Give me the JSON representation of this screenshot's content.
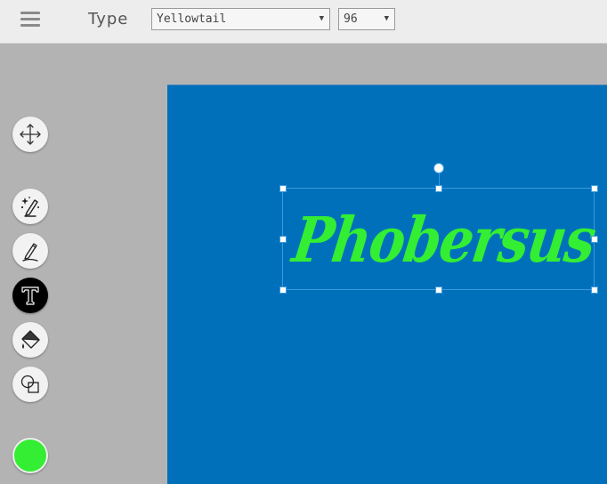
{
  "toolbar": {
    "menu_icon": "hamburger-menu-icon",
    "tool_name": "Type",
    "font_family": {
      "value": "Yellowtail",
      "arrow": "▼"
    },
    "font_size": {
      "value": "96",
      "arrow": "▼"
    }
  },
  "tools": [
    {
      "name": "move",
      "icon": "move-arrows-icon",
      "active": false
    },
    {
      "name": "magic-pen",
      "icon": "magic-pen-icon",
      "active": false
    },
    {
      "name": "pen",
      "icon": "pen-icon",
      "active": false
    },
    {
      "name": "type",
      "icon": "type-text-icon",
      "active": true
    },
    {
      "name": "fill",
      "icon": "paint-bucket-icon",
      "active": false
    },
    {
      "name": "shapes",
      "icon": "shapes-icon",
      "active": false
    }
  ],
  "colors": {
    "current": "#33ee33",
    "canvas_background": "#0070bb",
    "selection": "#3a9ae0"
  },
  "canvas": {
    "text_object": {
      "text": "Phobersus",
      "color": "#33ee33"
    }
  }
}
